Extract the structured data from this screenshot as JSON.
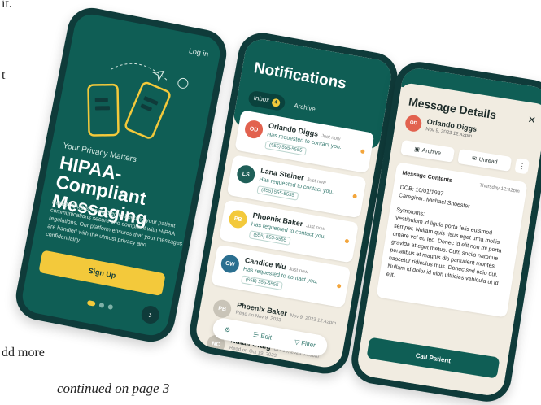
{
  "doc": {
    "fragment_top": "it.",
    "fragment_mid": "t",
    "fragment_bottom": "dd more",
    "footer": "continued on page 3"
  },
  "phone1": {
    "login": "Log in",
    "kicker": "Your Privacy Matters",
    "title": "HIPAA-Compliant Messaging",
    "body": "Pulaski CMS is committed to keeping your patient communications secure and compliant with HIPAA regulations. Our platform ensures that your messages are handled with the utmost privacy and confidentiality.",
    "signup": "Sign Up",
    "next_icon": "chevron-right-icon"
  },
  "phone2": {
    "title": "Notifications",
    "tabs": [
      {
        "label": "Inbox",
        "badge": "4"
      },
      {
        "label": "Archive"
      }
    ],
    "notifications": [
      {
        "initials": "OD",
        "name": "Orlando Diggs",
        "time": "Just now",
        "message": "Has requested to contact you.",
        "phone": "(555) 555-5555",
        "color": "#e2624f",
        "unread": true
      },
      {
        "initials": "LS",
        "name": "Lana Steiner",
        "time": "Just now",
        "message": "Has requested to contact you.",
        "phone": "(555) 555-5555",
        "color": "#1f5f58",
        "unread": true
      },
      {
        "initials": "PB",
        "name": "Phoenix Baker",
        "time": "Just now",
        "message": "Has requested to contact you.",
        "phone": "(555) 555-5555",
        "color": "#f3c93b",
        "unread": true
      },
      {
        "initials": "CW",
        "name": "Candice Wu",
        "time": "Just now",
        "message": "Has requested to contact you.",
        "phone": "(555) 555-5555",
        "color": "#2a6f90",
        "unread": true
      },
      {
        "initials": "PB",
        "name": "Phoenix Baker",
        "time": "Nov 9, 2023 12:42pm",
        "subtle": "Read on Nov 9, 2023",
        "color": "#c9c4b8"
      },
      {
        "initials": "NC",
        "name": "Natali Craig",
        "time": "Oct 19, 2023 3:16pm",
        "subtle": "Read on Oct 19, 2023",
        "color": "#c9c4b8"
      }
    ],
    "toolbar": {
      "settings_icon": "gear-icon",
      "edit": "Edit",
      "filter": "Filter"
    }
  },
  "phone3": {
    "title": "Message Details",
    "sender": {
      "initials": "OD",
      "name": "Orlando Diggs",
      "date": "Nov 9, 2023 12:42pm"
    },
    "archive": "Archive",
    "unread": "Unread",
    "contents_header": "Message Contents",
    "contents_time": "Thursday 12:42pm",
    "dob": "DOB: 10/01/1987",
    "caregiver": "Caregiver: Michael Shoester",
    "symptoms_label": "Symptoms:",
    "symptoms_text": "Vestibulum id ligula porta felis euismod semper. Nullam quis risus eget urna mollis ornare vel eu leo. Donec id elit non mi porta gravida at eget metus. Cum sociis natoque penatibus et magnis dis parturient montes, nascetur ridiculus mus. Donec sed odio dui. Nullam id dolor id nibh ultricies vehicula ut id elit.",
    "call": "Call Patient"
  },
  "colors": {
    "brand_green": "#0f5e55",
    "accent_yellow": "#f3c93b",
    "dark_frame": "#0f3b3a"
  }
}
